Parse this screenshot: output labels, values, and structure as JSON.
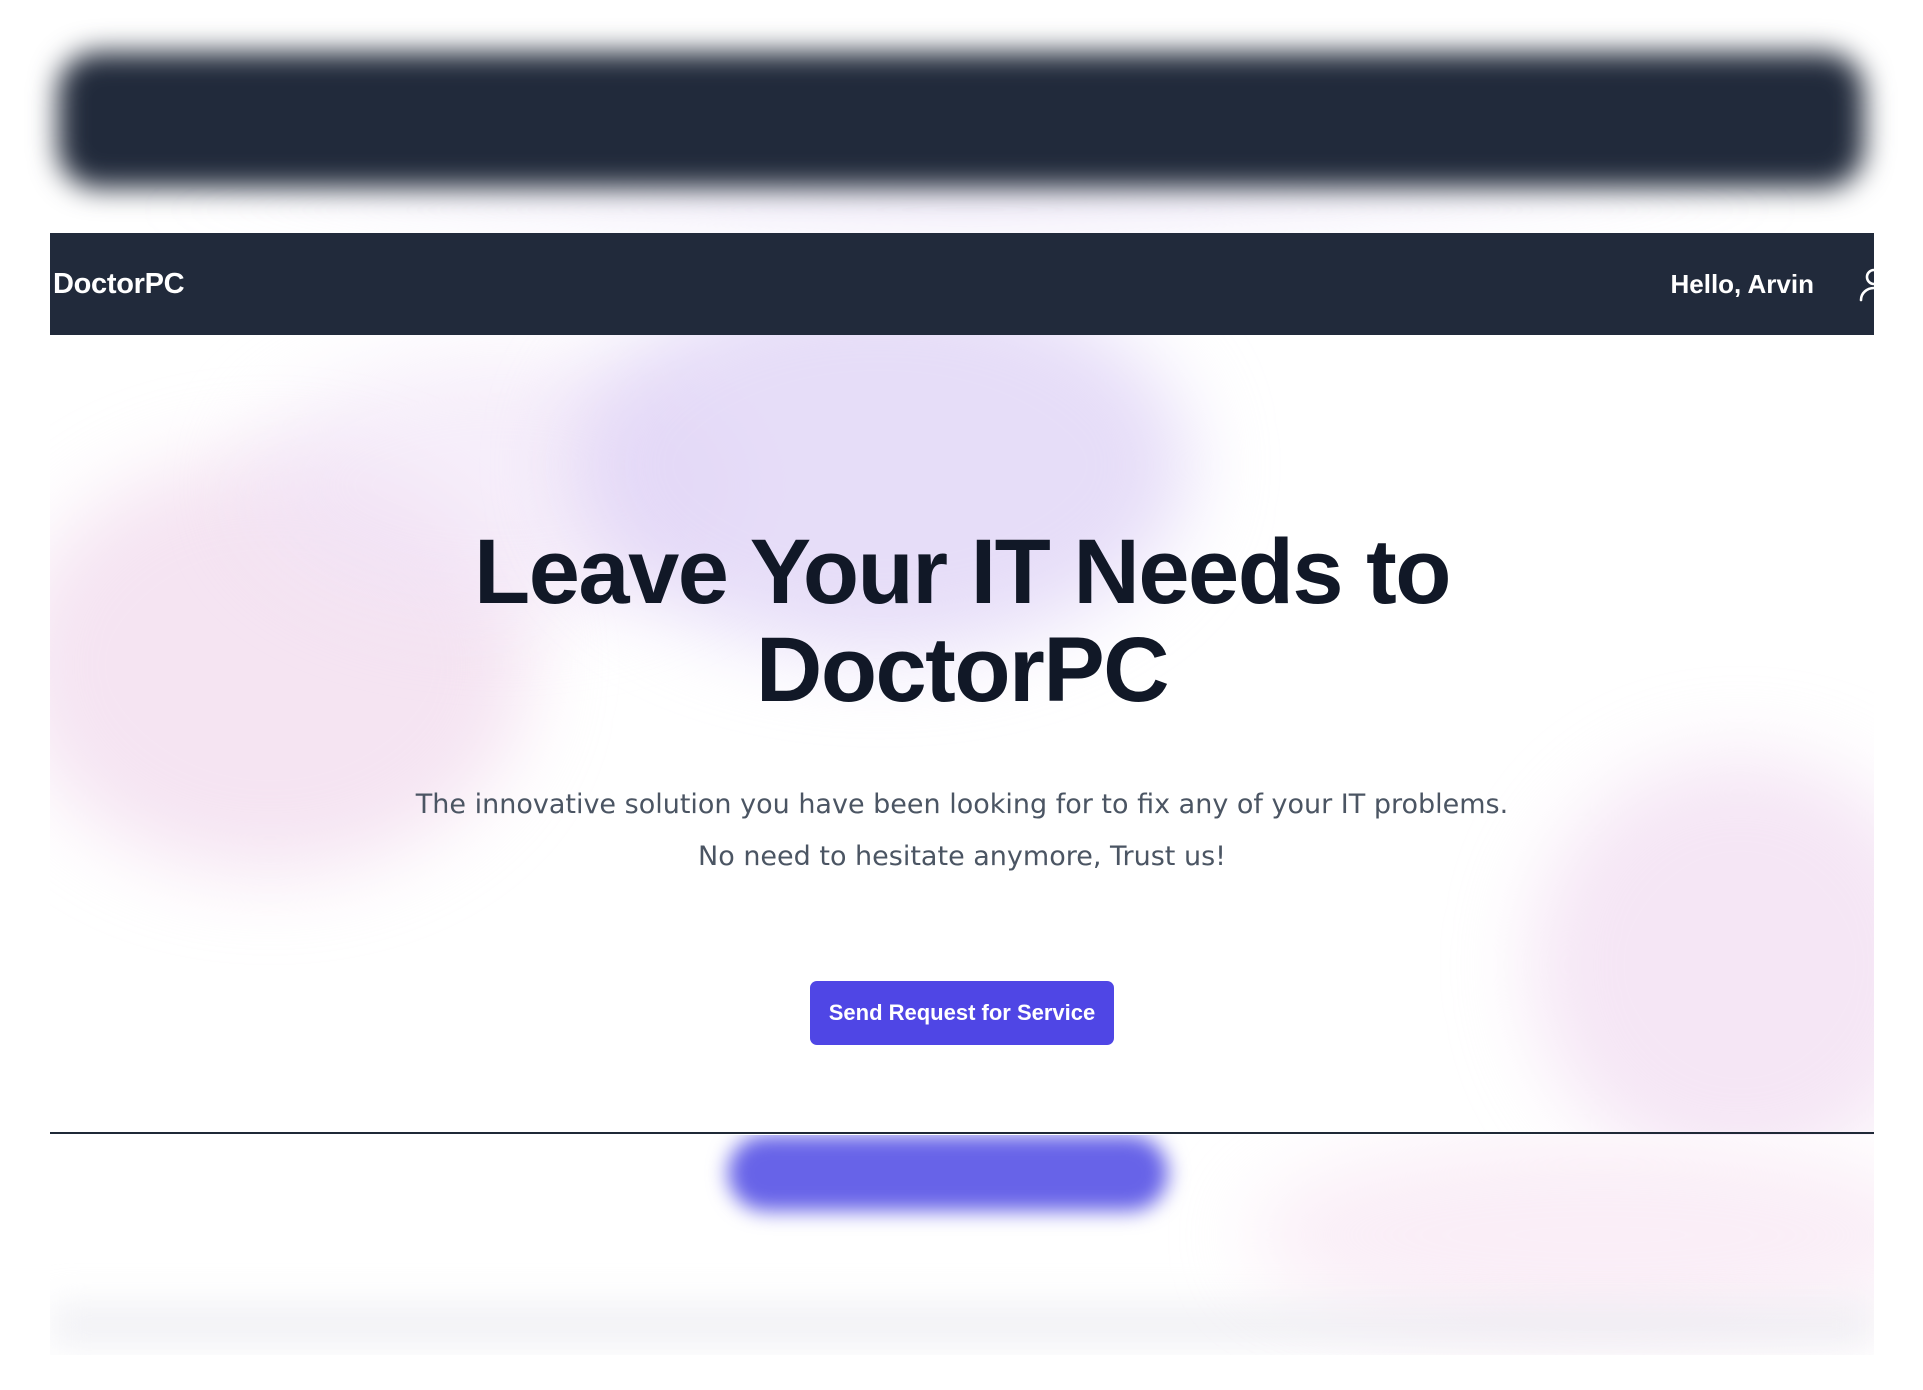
{
  "navbar": {
    "brand": "DoctorPC",
    "greeting": "Hello, Arvin",
    "user_icon": "user-icon"
  },
  "hero": {
    "title": "Leave Your IT Needs to DoctorPC",
    "subtitle": "The innovative solution you have been looking for to fix any of your IT problems. No need to hesitate anymore, Trust us!",
    "cta_label": "Send Request for Service"
  },
  "colors": {
    "navbar_bg": "#212a3b",
    "title": "#111827",
    "subtitle": "#4b5563",
    "cta_bg": "#4f46e5",
    "cta_text": "#ffffff"
  }
}
